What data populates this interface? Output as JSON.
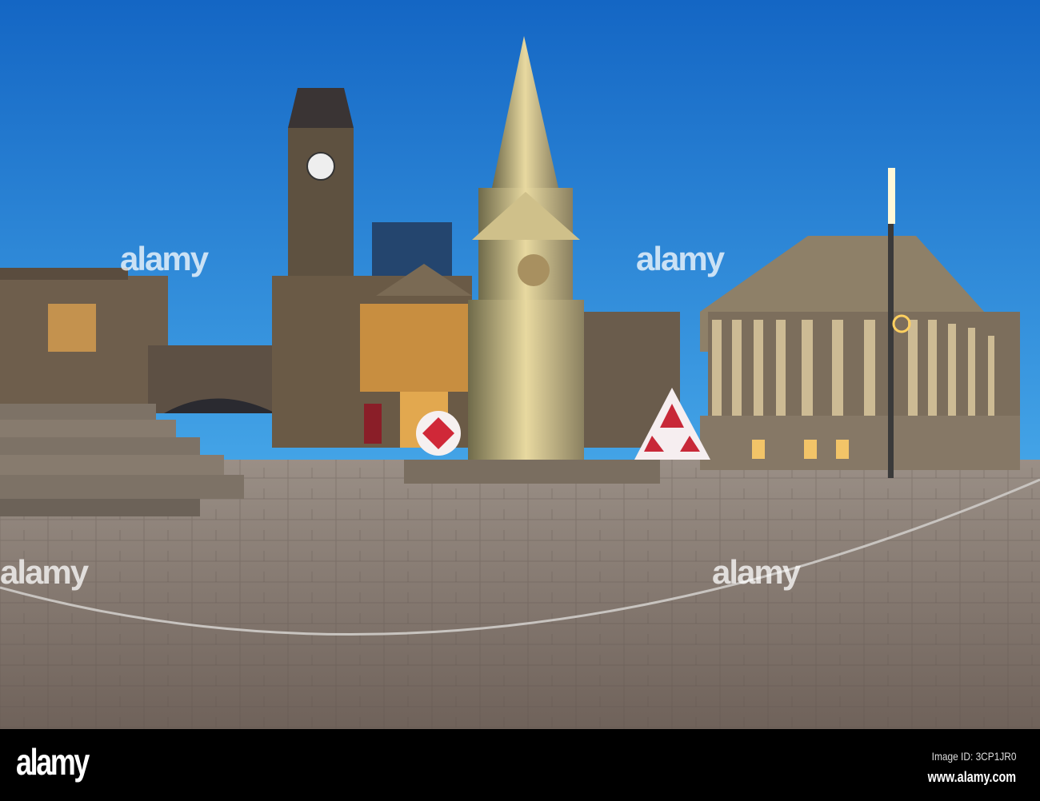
{
  "watermark": {
    "text": "alamy"
  },
  "footer": {
    "logo": "alamy",
    "image_id": "Image ID: 3CP1JR0",
    "url": "www.alamy.com"
  },
  "colors": {
    "sky_top": "#1466c4",
    "sky_bottom": "#3ea0e6",
    "paving": "#8c8078",
    "stone": "#8a7a66",
    "light": "#f5c060"
  }
}
